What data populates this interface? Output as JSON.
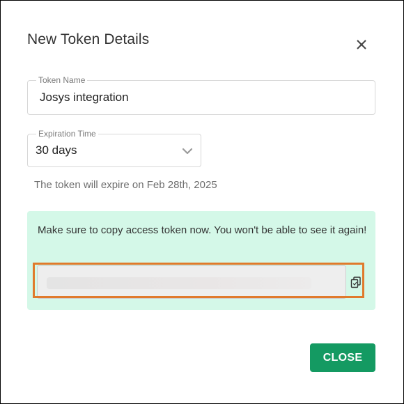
{
  "dialog": {
    "title": "New Token Details",
    "close_icon": "close-icon"
  },
  "token_name": {
    "label": "Token Name",
    "value": "Josys integration"
  },
  "expiration": {
    "label": "Expiration Time",
    "value": "30 days",
    "icon": "chevron-down-icon",
    "hint": "The token will expire on Feb 28th, 2025"
  },
  "notice": {
    "message": "Make sure to copy access token now. You won't be able to see it again!",
    "background_color": "#d4f8e8",
    "highlight_color": "#e07a2c",
    "copy_icon": "copy-icon"
  },
  "actions": {
    "close_label": "CLOSE",
    "close_color": "#149a62"
  }
}
